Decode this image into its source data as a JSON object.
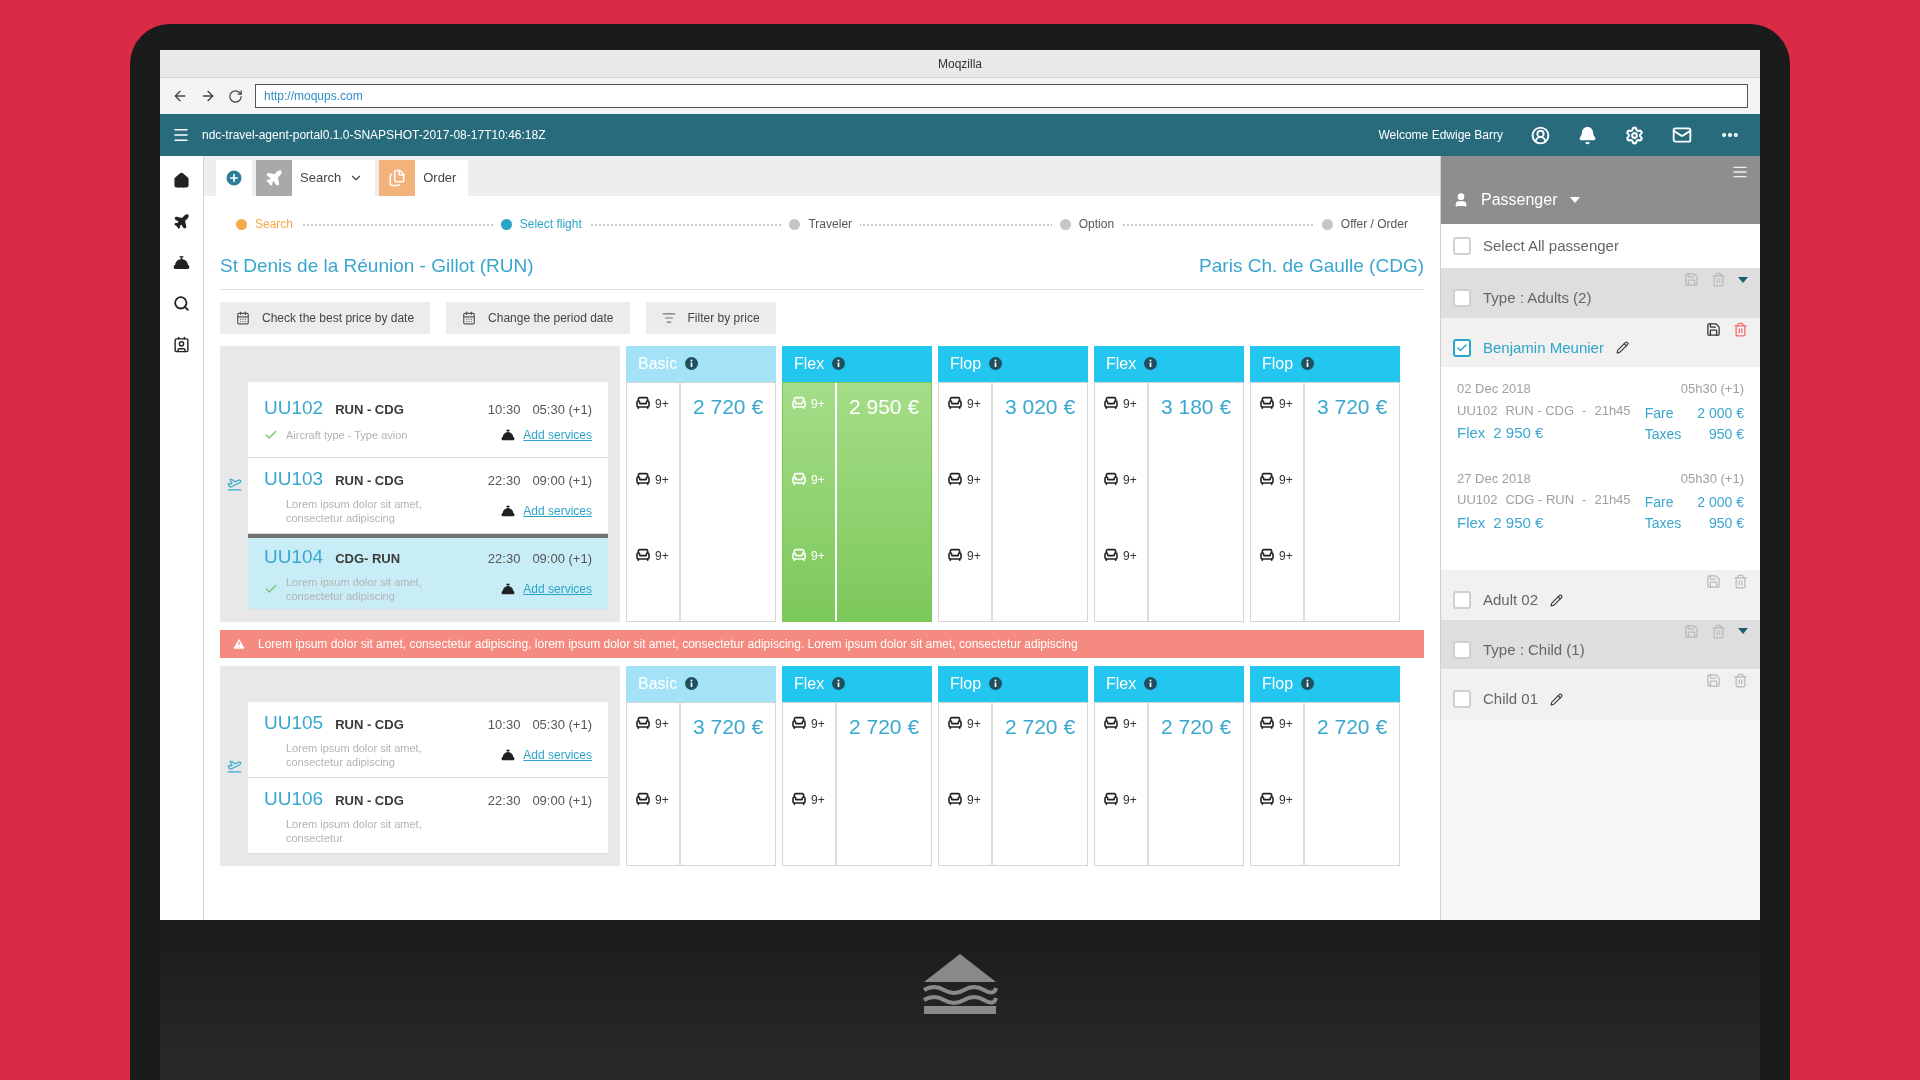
{
  "browser": {
    "title": "Moqzilla",
    "url": "http://moqups.com"
  },
  "app_bar": {
    "app_name": "ndc-travel-agent-portal0.1.0-SNAPSHOT-2017-08-17T10:46:18Z",
    "welcome": "Welcome Edwige Barry"
  },
  "tabs": [
    {
      "label": "Search",
      "kind": "search"
    },
    {
      "label": "Order",
      "kind": "order"
    }
  ],
  "steps": [
    {
      "label": "Search",
      "done": true,
      "selected": false
    },
    {
      "label": "Select flight",
      "done": false,
      "selected": true
    },
    {
      "label": "Traveler",
      "done": false,
      "selected": false
    },
    {
      "label": "Option",
      "done": false,
      "selected": false
    },
    {
      "label": "Offer / Order",
      "done": false,
      "selected": false
    }
  ],
  "route": {
    "origin": "St Denis de la Réunion - Gillot (RUN)",
    "destination": "Paris Ch. de Gaulle (CDG)"
  },
  "actions": [
    {
      "label": "Check the best price by date",
      "kind": "calendar"
    },
    {
      "label": "Change the period date",
      "kind": "calendar"
    },
    {
      "label": "Filter by price",
      "kind": "filter"
    }
  ],
  "journeys": [
    {
      "flights": [
        {
          "number": "UU102",
          "route": "RUN - CDG",
          "departure": "10:30",
          "arrival": "05:30 (+1)",
          "note": "Aircraft type - Type avion",
          "service_link": "Add services",
          "checked": true,
          "selected": false
        },
        {
          "number": "UU103",
          "route": "RUN - CDG",
          "departure": "22:30",
          "arrival": "09:00 (+1)",
          "note": "Lorem ipsum dolor sit amet, consectetur adipiscing",
          "service_link": "Add services",
          "checked": false,
          "selected": false
        },
        {
          "number": "UU104",
          "route": "CDG- RUN",
          "departure": "22:30",
          "arrival": "09:00 (+1)",
          "note": "Lorem ipsum dolor sit amet, consectetur adipiscing",
          "service_link": "Add services",
          "checked": true,
          "selected": true
        }
      ],
      "fares": [
        {
          "name": "Basic",
          "color": "#a4e3f7",
          "price": "2 720 €",
          "selected": false,
          "seats": [
            "9+",
            "9+",
            "9+"
          ]
        },
        {
          "name": "Flex",
          "color": "#22c6ef",
          "price": "2 950 €",
          "selected": true,
          "seats": [
            "9+",
            "9+",
            "9+"
          ]
        },
        {
          "name": "Flop",
          "color": "#22c6ef",
          "price": "3 020 €",
          "selected": false,
          "seats": [
            "9+",
            "9+",
            "9+"
          ]
        },
        {
          "name": "Flex",
          "color": "#22c6ef",
          "price": "3 180 €",
          "selected": false,
          "seats": [
            "9+",
            "9+",
            "9+"
          ]
        },
        {
          "name": "Flop",
          "color": "#22c6ef",
          "price": "3 720 €",
          "selected": false,
          "seats": [
            "9+",
            "9+",
            "9+"
          ]
        }
      ]
    },
    {
      "alert": "Lorem ipsum dolor sit amet, consectetur adipiscing, lorem ipsum dolor sit amet, consectetur adipiscing. Lorem ipsum dolor sit amet, consectetur adipiscing",
      "flights": [
        {
          "number": "UU105",
          "route": "RUN - CDG",
          "departure": "10:30",
          "arrival": "05:30 (+1)",
          "note": "Lorem ipsum dolor sit amet, consectetur adipiscing",
          "service_link": "Add services",
          "checked": false,
          "selected": false
        },
        {
          "number": "UU106",
          "route": "RUN - CDG",
          "departure": "22:30",
          "arrival": "09:00 (+1)",
          "note": "Lorem ipsum dolor sit amet, consectetur",
          "checked": false,
          "selected": false
        }
      ],
      "fares": [
        {
          "name": "Basic",
          "color": "#a4e3f7",
          "price": "3 720 €",
          "selected": false,
          "seats": [
            "9+",
            "9+"
          ]
        },
        {
          "name": "Flex",
          "color": "#22c6ef",
          "price": "2 720 €",
          "selected": false,
          "seats": [
            "9+",
            "9+"
          ]
        },
        {
          "name": "Flop",
          "color": "#22c6ef",
          "price": "2 720 €",
          "selected": false,
          "seats": [
            "9+",
            "9+"
          ]
        },
        {
          "name": "Flex",
          "color": "#22c6ef",
          "price": "2 720 €",
          "selected": false,
          "seats": [
            "9+",
            "9+"
          ]
        },
        {
          "name": "Flop",
          "color": "#22c6ef",
          "price": "2 720 €",
          "selected": false,
          "seats": [
            "9+",
            "9+"
          ]
        }
      ]
    }
  ],
  "passenger_panel": {
    "title": "Passenger",
    "select_all": {
      "label": "Select All passenger",
      "checked": false
    },
    "groups": [
      {
        "label": "Type : Adults (2)",
        "checked": false,
        "passengers": [
          {
            "name": "Benjamin Meunier",
            "checked": true,
            "segments": [
              {
                "date": "02 Dec 2018",
                "flight": "UU102",
                "route": "RUN - CDG",
                "separator": "-",
                "departure": "21h45",
                "arrival": "05h30 (+1)",
                "fare_name": "Flex",
                "total": "2 950 €",
                "fare_label": "Fare",
                "fare": "2 000 €",
                "taxes_label": "Taxes",
                "taxes": "950 €"
              },
              {
                "date": "27 Dec 2018",
                "flight": "UU102",
                "route": "CDG - RUN",
                "separator": "-",
                "departure": "21h45",
                "arrival": "05h30 (+1)",
                "fare_name": "Flex",
                "total": "2 950 €",
                "fare_label": "Fare",
                "fare": "2 000 €",
                "taxes_label": "Taxes",
                "taxes": "950 €"
              }
            ]
          },
          {
            "name": "Adult 02",
            "checked": false
          }
        ]
      },
      {
        "label": "Type : Child (1)",
        "checked": false,
        "passengers": [
          {
            "name": "Child 01",
            "checked": false
          }
        ]
      }
    ]
  }
}
